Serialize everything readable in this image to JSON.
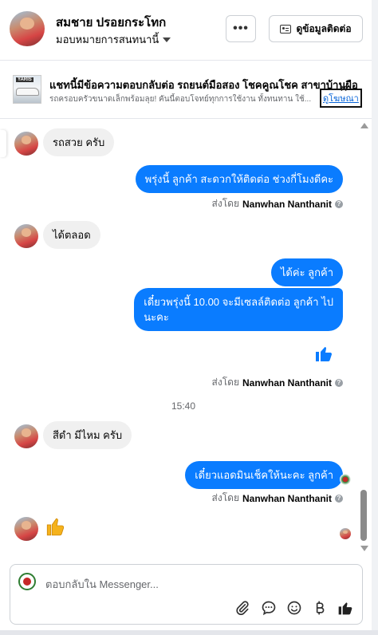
{
  "header": {
    "name": "สมชาย ปรอยกระโทก",
    "assign": "มอบหมายการสนทนานี้",
    "more": "•••",
    "contact_button": "ดูข้อมูลติดต่อ"
  },
  "ad": {
    "thumb_tag": "YARIS",
    "title": "แชทนี้มีข้อความตอบกลับต่อ รถยนต์มือสอง โชคคูณโชค สาขาบ้านผือ",
    "description": "รถครอบครัวขนาดเล็กพร้อมลุย! คันนี้ตอบโจทย์ทุกการใช้งาน ทั้งทนทาน ใช้...",
    "link": "ดูโฆษณา",
    "close": "✕"
  },
  "messages": [
    {
      "side": "in",
      "text": "รถสวย ครับ"
    },
    {
      "side": "out",
      "text": "พรุ่งนี้ ลูกค้า สะดวกให้ติดต่อ ช่วงกี่โมงดีคะ"
    },
    {
      "side": "in",
      "text": "ได้ตลอด"
    },
    {
      "side": "out",
      "text": "ได้ค่ะ  ลูกค้า"
    },
    {
      "side": "out",
      "text": "เดี๋ยวพรุ่งนี้ 10.00 จะมีเซลล์ติดต่อ ลูกค้า ไป",
      "line2": "นะคะ"
    },
    {
      "side": "in",
      "text": "สีดำ มีไหม ครับ"
    },
    {
      "side": "out",
      "text": "เดี๋ยวแอดมินเช็คให้นะคะ ลูกค้า"
    }
  ],
  "sent_by": {
    "prefix": "ส่งโดย",
    "agent": "Nanwhan Nanthanit",
    "info": "?"
  },
  "timestamp": "15:40",
  "composer": {
    "placeholder": "ตอบกลับใน Messenger..."
  },
  "colors": {
    "outgoing": "#0a7cff",
    "incoming": "#f0f0f0",
    "like": "#0a7cff"
  },
  "icons": [
    "paperclip-icon",
    "chat-icon",
    "emoji-icon",
    "baht-icon",
    "thumbs-up-icon"
  ]
}
